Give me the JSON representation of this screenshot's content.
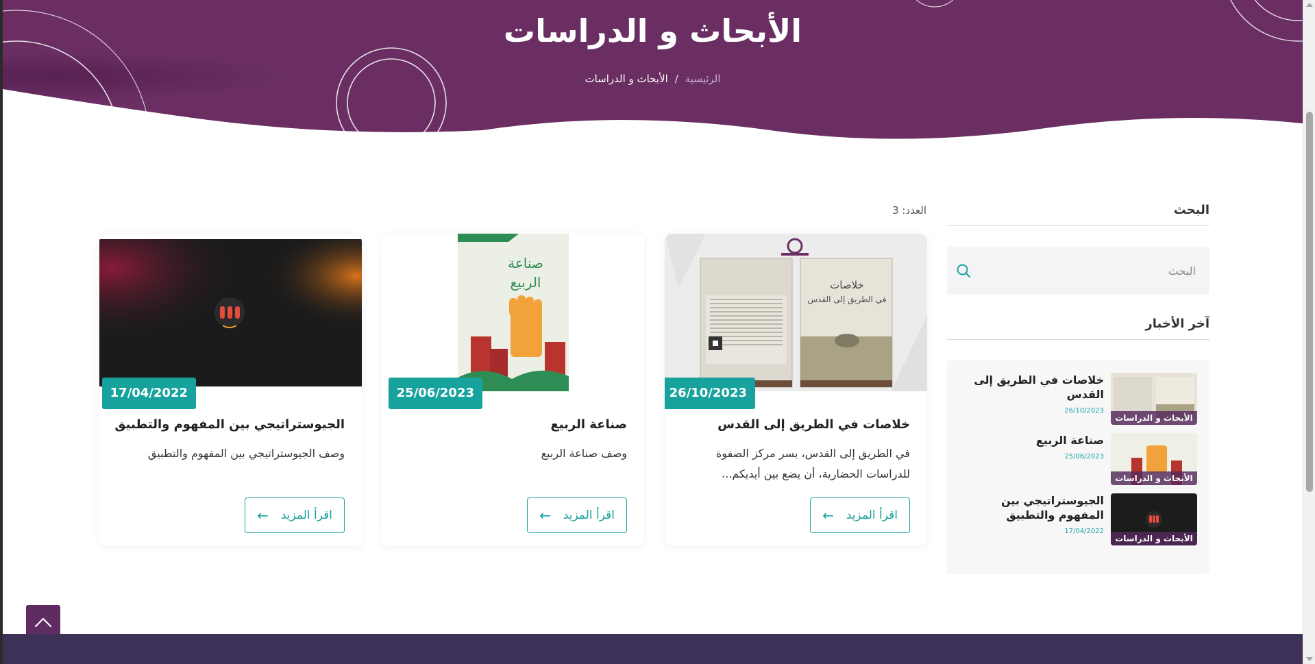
{
  "hero": {
    "title": "الأبحاث و الدراسات",
    "breadcrumb_home": "الرئيسية",
    "breadcrumb_separator": "/",
    "breadcrumb_current": "الأبحاث و الدراسات"
  },
  "colors": {
    "hero_purple": "#6a2e63",
    "accent_teal": "#17a29d",
    "footer": "#3e3157"
  },
  "count": {
    "label": "العدد: 3"
  },
  "cards": [
    {
      "date": "26/10/2023",
      "title": "خلاصات في الطريق إلى القدس",
      "description": "في الطريق إلى القدس، يسر مركز الصفوة للدراسات الحضارية، أن يضع بين أيديكم...",
      "read_more": "اقرأ المزيد"
    },
    {
      "date": "25/06/2023",
      "title": "صناعة الربيع",
      "description": "وصف صناعة الربيع",
      "read_more": "اقرأ المزيد"
    },
    {
      "date": "17/04/2022",
      "title": "الجيوستراتيجي بين المفهوم والتطبيق",
      "description": "وصف الجيوستراتيجي بين المفهوم والتطبيق",
      "read_more": "اقرأ المزيد"
    }
  ],
  "sidebar": {
    "search_heading": "البحث",
    "search_placeholder": "البحث",
    "news_heading": "آخر الأخبار",
    "news": [
      {
        "title": "خلاصات في الطريق إلى القدس",
        "date": "26/10/2023",
        "category": "الأبحاث و الدراسات"
      },
      {
        "title": "صناعة الربيع",
        "date": "25/06/2023",
        "category": "الأبحاث و الدراسات"
      },
      {
        "title": "الجيوستراتيجي بين المفهوم والتطبيق",
        "date": "17/04/2022",
        "category": "الأبحاث و الدراسات"
      }
    ]
  },
  "book_covers": {
    "quds_cover_title": "خلاصات في الطريق إلى القدس",
    "spring_cover_title": "صناعة الربيع"
  }
}
